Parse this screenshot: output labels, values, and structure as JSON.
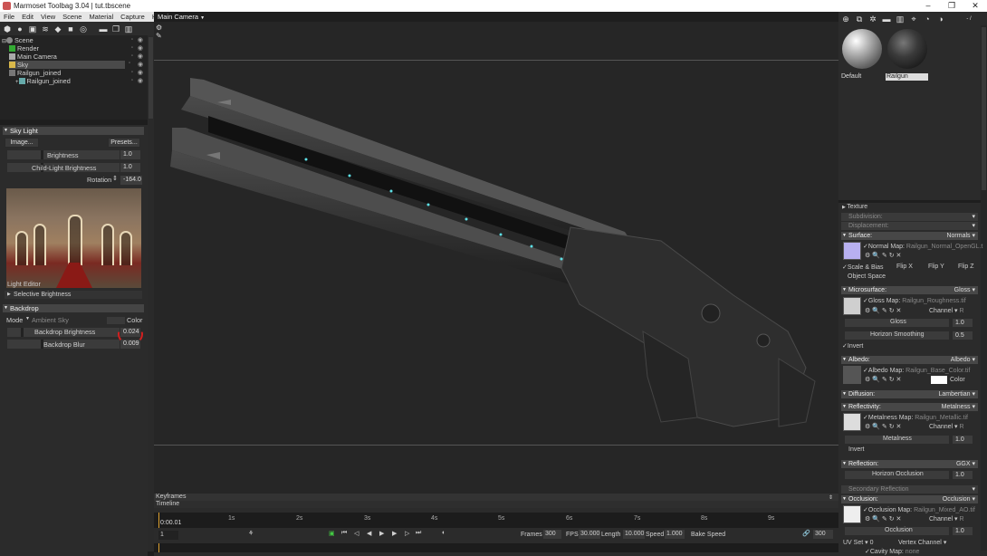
{
  "window": {
    "title": "Marmoset Toolbag 3.04  |  tut.tbscene"
  },
  "menu": [
    "File",
    "Edit",
    "View",
    "Scene",
    "Material",
    "Capture",
    "Help"
  ],
  "scene_tree": [
    {
      "label": "Scene",
      "indent": 0
    },
    {
      "label": "Render",
      "indent": 1
    },
    {
      "label": "Main Camera",
      "indent": 1
    },
    {
      "label": "Sky",
      "indent": 1,
      "selected": true
    },
    {
      "label": "Railgun_joined",
      "indent": 1
    },
    {
      "label": "Railgun_joined",
      "indent": 2
    }
  ],
  "sky_light": {
    "header": "Sky Light",
    "image_btn": "Image...",
    "presets_btn": "Presets...",
    "brightness_label": "Brightness",
    "brightness_val": "1.0",
    "child_label": "Child-Light Brightness",
    "child_val": "1.0",
    "rotation_label": "Rotation",
    "rotation_val": "-164.0",
    "light_editor": "Light Editor",
    "selective": "Selective Brightness"
  },
  "backdrop": {
    "header": "Backdrop",
    "mode_label": "Mode",
    "mode_value": "Ambient Sky",
    "color_label": "Color",
    "brightness_label": "Backdrop Brightness",
    "brightness_val": "0.024",
    "blur_label": "Backdrop Blur",
    "blur_val": "0.009"
  },
  "viewport": {
    "camera": "Main Camera"
  },
  "timeline": {
    "keyframes": "Keyframes",
    "timeline": "Timeline",
    "current": "0:00.01",
    "ticks": [
      "1s",
      "2s",
      "3s",
      "4s",
      "5s",
      "6s",
      "7s",
      "8s",
      "9s"
    ],
    "frame_field": "1",
    "frames_label": "Frames",
    "frames_val": "300",
    "fps_label": "FPS",
    "fps_val": "30.000",
    "length_label": "Length",
    "length_val": "10.000",
    "speed_label": "Speed",
    "speed_val": "1.000",
    "bake": "Bake Speed",
    "end_val": "300"
  },
  "materials": [
    {
      "name": "Default"
    },
    {
      "name": "Railgun",
      "selected": true
    }
  ],
  "material_panel": {
    "texture": "Texture",
    "subdivision": "Subdivision:",
    "displacement": "Displacement:",
    "surface": "Surface:",
    "surface_val": "Normals",
    "normal_map": "Normal Map:",
    "normal_file": "Railgun_Normal_OpenGL.t",
    "scale_bias": "Scale & Bias",
    "flipx": "Flip X",
    "flipy": "Flip Y",
    "flipz": "Flip Z",
    "object_space": "Object Space",
    "microsurface": "Microsurface:",
    "micro_val": "Gloss",
    "gloss_map": "Gloss Map:",
    "gloss_file": "Railgun_Roughness.tif",
    "channel": "Channel",
    "channel_r": "R",
    "gloss": "Gloss",
    "gloss_val": "1.0",
    "horizon_smoothing": "Horizon Smoothing",
    "horizon_val": "0.5",
    "invert": "Invert",
    "albedo": "Albedo:",
    "albedo_val": "Albedo",
    "albedo_map": "Albedo Map:",
    "albedo_file": "Railgun_Base_Color.tif",
    "color": "Color",
    "diffusion": "Diffusion:",
    "diffusion_val": "Lambertian",
    "reflectivity": "Reflectivity:",
    "reflectivity_val": "Metalness",
    "metal_map": "Metalness Map:",
    "metal_file": "Railgun_Metallic.tif",
    "metalness": "Metalness",
    "metal_val": "1.0",
    "invert2": "Invert",
    "reflection": "Reflection:",
    "reflection_val": "GGX",
    "horizon_occlusion": "Horizon Occlusion",
    "ho_val": "1.0",
    "secondary": "Secondary Reflection",
    "occlusion": "Occlusion:",
    "occlusion_val": "Occlusion",
    "occ_map": "Occlusion Map:",
    "occ_file": "Railgun_Mixed_AO.tif",
    "occ_label": "Occlusion",
    "occ_val": "1.0",
    "uvset": "UV Set",
    "uvset_val": "0",
    "vertex_channel": "Vertex Channel",
    "cavity_map": "Cavity Map:",
    "cavity_file": "none"
  }
}
